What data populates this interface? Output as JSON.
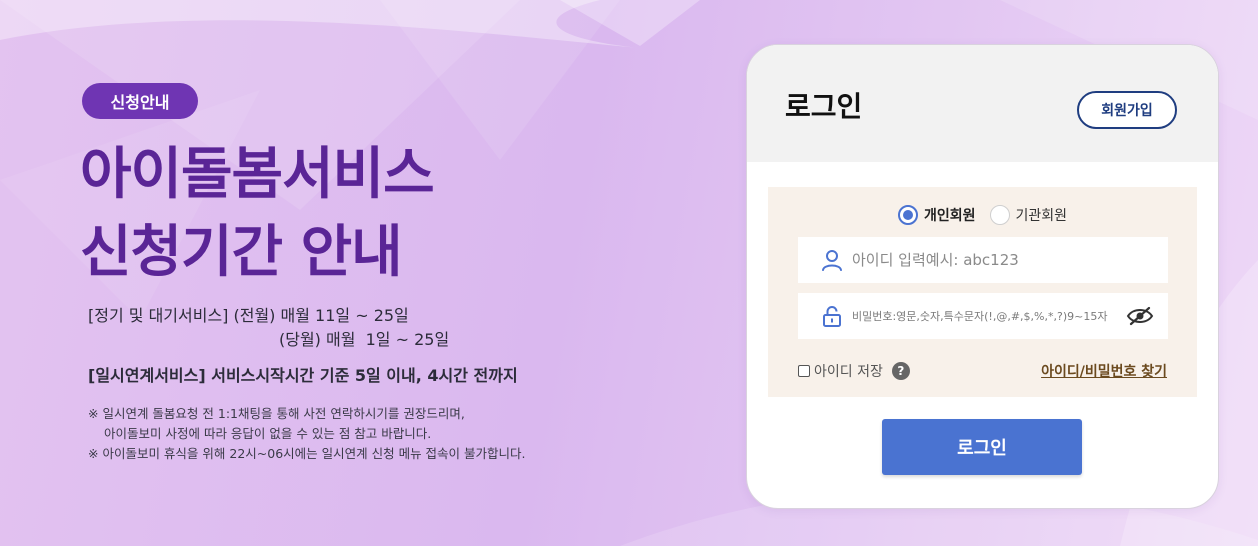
{
  "notice": {
    "badge": "신청안내",
    "title_line1": "아이돌봄서비스",
    "title_line2": "신청기간 안내",
    "period_line1": "[정기 및 대기서비스] (전월) 매월 11일 ~ 25일",
    "period_line2": "(당월) 매월  1일 ~ 25일",
    "instant_line": "[일시연계서비스] 서비스시작시간 기준 5일 이내, 4시간 전까지",
    "note1_line1": "※ 일시연계 돌봄요청 전 1:1채팅을 통해 사전 연락하시기를 권장드리며,",
    "note1_line2": "아이돌보미 사정에 따라 응답이 없을 수 있는 점 참고 바랍니다.",
    "note2": "※ 아이돌보미 휴식을 위해 22시~06시에는 일시연계 신청 메뉴 접속이 불가합니다."
  },
  "login": {
    "title": "로그인",
    "join_button": "회원가입",
    "member_types": [
      {
        "label": "개인회원",
        "selected": true
      },
      {
        "label": "기관회원",
        "selected": false
      }
    ],
    "id_placeholder": "아이디 입력예시: abc123",
    "pw_placeholder": "비밀번호:영문,숫자,특수문자(!,@,#,$,%,*,?)9~15자",
    "save_id_label": "아이디 저장",
    "help_symbol": "?",
    "find_link": "아이디/비밀번호 찾기",
    "submit_button": "로그인"
  },
  "colors": {
    "accent_purple": "#5a2596",
    "badge_purple": "#6f35b3",
    "login_blue": "#4a73d1",
    "join_navy": "#1f3d80",
    "form_bg": "#f8f1ea"
  },
  "icons": {
    "id_field": "user-icon",
    "pw_field": "lock-icon",
    "pw_toggle": "eye-off-icon",
    "help": "help-icon"
  }
}
